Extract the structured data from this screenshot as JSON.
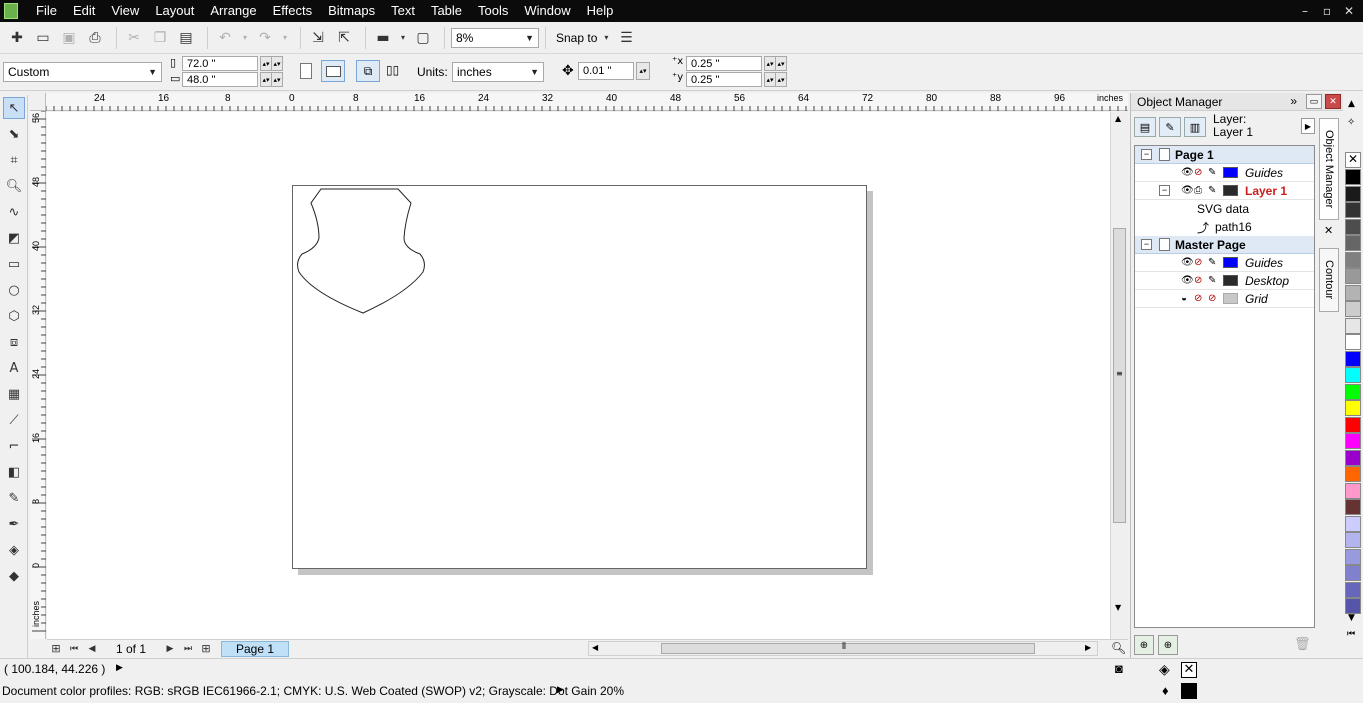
{
  "menu": [
    "File",
    "Edit",
    "View",
    "Layout",
    "Arrange",
    "Effects",
    "Bitmaps",
    "Text",
    "Table",
    "Tools",
    "Window",
    "Help"
  ],
  "window_controls": [
    "–",
    "▫",
    "✕"
  ],
  "toolbar": {
    "zoom_value": "8%",
    "snap_label": "Snap to"
  },
  "property_bar": {
    "page_size": "Custom",
    "width": "72.0 \"",
    "height": "48.0 \"",
    "units_label": "Units:",
    "units_value": "inches",
    "nudge": "0.01 \"",
    "dup_x": "0.25 \"",
    "dup_y": "0.25 \""
  },
  "ruler": {
    "h_ticks": [
      "24",
      "16",
      "8",
      "0",
      "8",
      "16",
      "24",
      "32",
      "40",
      "48",
      "56",
      "64",
      "72",
      "80",
      "88",
      "96"
    ],
    "h_unit": "inches",
    "v_ticks": [
      "56",
      "48",
      "40",
      "32",
      "24",
      "16",
      "8",
      "0"
    ],
    "v_unit": "inches"
  },
  "page_nav": {
    "count": "1 of 1",
    "tab": "Page 1"
  },
  "object_manager": {
    "title": "Object Manager",
    "layer_label": "Layer:",
    "layer_name": "Layer 1",
    "tree": {
      "page1": "Page 1",
      "guides1": "Guides",
      "layer1": "Layer 1",
      "svg_data": "SVG data",
      "path": "path16",
      "master_page": "Master Page",
      "guides2": "Guides",
      "desktop": "Desktop",
      "grid": "Grid"
    }
  },
  "side_tabs": {
    "object_manager": "Object Manager",
    "contour": "Contour"
  },
  "status": {
    "coordinates": "( 100.184, 44.226 )",
    "color_profiles": "Document color profiles: RGB: sRGB IEC61966-2.1; CMYK: U.S. Web Coated (SWOP) v2; Grayscale: Dot Gain 20%"
  },
  "colors": {
    "layer_active": "#cc1f1f",
    "guides_swatch": "#0000ff",
    "layer_swatch": "#2a2a2a",
    "desktop_swatch": "#2a2a2a",
    "grid_swatch": "#c8c8c8",
    "page_tab": "#bfe0f7",
    "palette": [
      "#000000",
      "#1a1a1a",
      "#333333",
      "#4d4d4d",
      "#666666",
      "#808080",
      "#999999",
      "#b3b3b3",
      "#cccccc",
      "#e6e6e6",
      "#ffffff",
      "#0000ff",
      "#00ffff",
      "#00ff00",
      "#ffff00",
      "#ff0000",
      "#ff00ff",
      "#9900cc",
      "#ff6600",
      "#ff99cc",
      "#663333",
      "#ccccff",
      "#b3b3ee",
      "#9999dd",
      "#8080cc",
      "#6666bb",
      "#5555aa"
    ]
  }
}
